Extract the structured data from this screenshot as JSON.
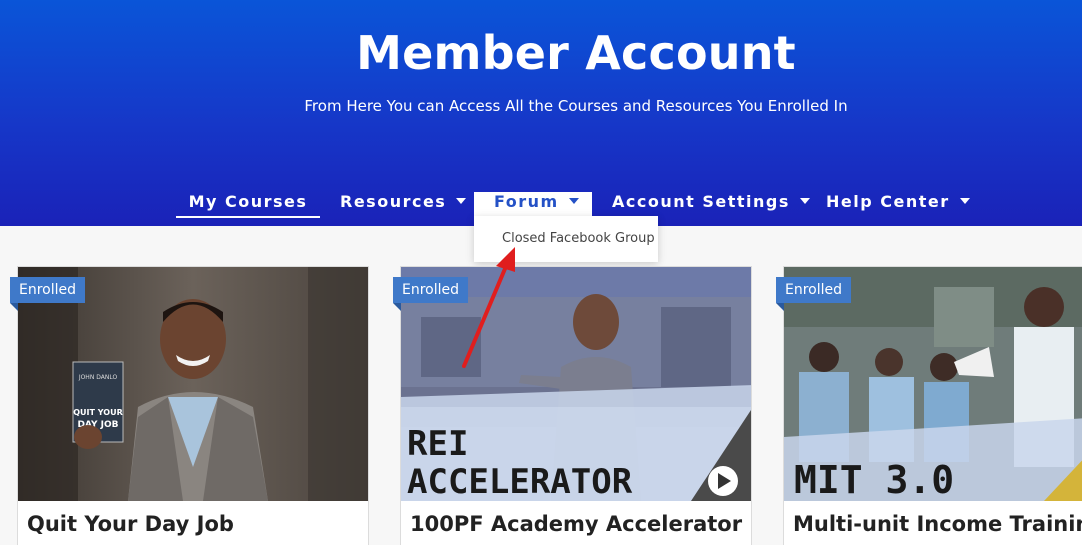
{
  "header": {
    "title": "Member Account",
    "subtitle": "From Here You can Access All the Courses and Resources You Enrolled In"
  },
  "nav": {
    "items": [
      {
        "label": "My Courses",
        "active": true,
        "has_dropdown": false
      },
      {
        "label": "Resources",
        "has_dropdown": true
      },
      {
        "label": "Forum",
        "hovered": true,
        "has_dropdown": true
      },
      {
        "label": "Account Settings",
        "has_dropdown": true
      },
      {
        "label": "Help Center",
        "has_dropdown": true
      }
    ],
    "forum_dropdown": [
      "Closed Facebook Group"
    ]
  },
  "courses": [
    {
      "title": "Quit Your Day Job",
      "badge": "Enrolled",
      "image_icon": "man-holding-book-photo",
      "book_text": [
        "QUIT YOUR",
        "DAY JOB"
      ]
    },
    {
      "title": "100PF Academy Accelerator",
      "badge": "Enrolled",
      "image_icon": "man-pointing-at-house-video",
      "overlay_text": [
        "REI",
        "ACCELERATOR"
      ]
    },
    {
      "title": "Multi-unit Income Training",
      "badge": "Enrolled",
      "image_icon": "crowd-with-megaphone-video",
      "overlay_text": [
        "MIT 3.0"
      ]
    }
  ],
  "colors": {
    "hero_top": "#0a55d8",
    "hero_bottom": "#1a22b8",
    "badge": "#3f79c9",
    "arrow": "#e01e1e",
    "accent_gold": "#d4b43a"
  }
}
